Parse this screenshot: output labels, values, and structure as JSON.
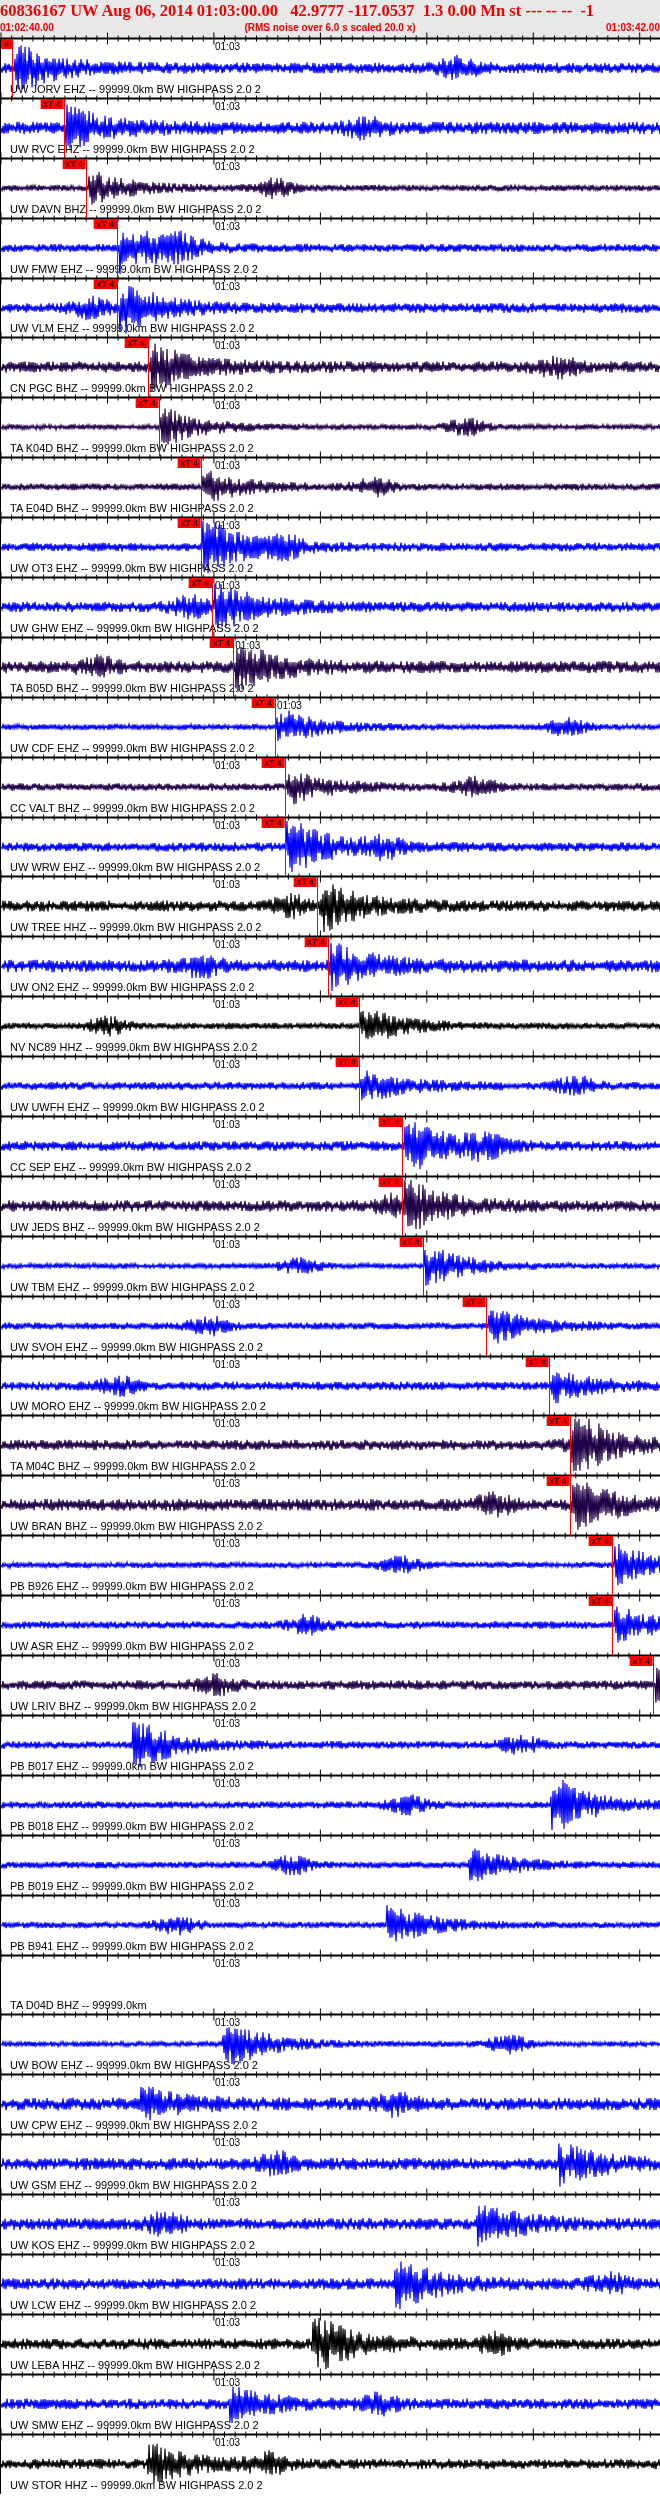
{
  "header": {
    "title": "60836167 UW Aug 06, 2014 01:03:00.00   42.9777 -117.0537  1.3 0.00 Mn st --- -- --  -1",
    "start_time": "01:02:40.00",
    "note": "(RMS noise over 6.0 s scaled 20.0 x)",
    "end_time": "01:03:42.00"
  },
  "traces": [
    {
      "label": "UW JORV EHZ -- 99999.0km BW HIGHPASS 2.0 2",
      "time_label": "01:03",
      "color": "#0000ff",
      "kind": "waveform",
      "pick": {
        "label": "4",
        "level": 0.017
      }
    },
    {
      "label": "UW RVC EHZ -- 99999.0km BW HIGHPASS 2.0 2",
      "time_label": "01:03",
      "color": "#0000ff",
      "kind": "waveform",
      "pick": {
        "label": "xT 4",
        "level": 0.095
      }
    },
    {
      "label": "UW DAVN BHZ -- 99999.0km BW HIGHPASS 2.0 2",
      "time_label": "01:03",
      "color": "#200048",
      "kind": "waveform",
      "pick": {
        "label": "xT 4",
        "level": 0.129
      }
    },
    {
      "label": "UW FMW EHZ -- 99999.0km BW HIGHPASS 2.0 2",
      "time_label": "01:03",
      "color": "#0000ff",
      "kind": "waveform",
      "pick": {
        "label": "xT 4",
        "level": 0.176
      }
    },
    {
      "label": "UW VLM EHZ -- 99999.0km BW HIGHPASS 2.0 2",
      "time_label": "01:03",
      "color": "#0000ff",
      "kind": "waveform",
      "pick": {
        "label": "xT 4",
        "level": 0.176
      }
    },
    {
      "label": "CN PGC BHZ -- 99999.0km BW HIGHPASS 2.0 2",
      "time_label": "01:03",
      "color": "#200048",
      "kind": "waveform",
      "pick": {
        "label": "xT 4",
        "level": 0.223
      }
    },
    {
      "label": "TA K04D BHZ -- 99999.0km BW HIGHPASS 2.0 2",
      "time_label": "01:03",
      "color": "#200048",
      "kind": "waveform",
      "pick": {
        "label": "xT 4",
        "level": 0.239
      }
    },
    {
      "label": "TA E04D BHZ -- 99999.0km BW HIGHPASS 2.0 2",
      "time_label": "01:03",
      "color": "#200048",
      "kind": "waveform",
      "pick": {
        "label": "xT 4",
        "level": 0.303
      }
    },
    {
      "label": "UW OT3 EHZ -- 99999.0km BW HIGHPASS 2.0 2",
      "time_label": "01:03",
      "color": "#0000ff",
      "kind": "waveform",
      "pick": {
        "label": "xT 4",
        "level": 0.303
      }
    },
    {
      "label": "UW GHW EHZ -- 99999.0km BW HIGHPASS 2.0 2",
      "time_label": "01:03",
      "color": "#0000ff",
      "kind": "waveform",
      "pick": {
        "label": "xT 4",
        "level": 0.32
      }
    },
    {
      "label": "TA B05D BHZ -- 99999.0km BW HIGHPASS 2.0 2",
      "time_label": "01:03",
      "color": "#200048",
      "kind": "waveform",
      "pick": {
        "label": "xT 4",
        "level": 0.352
      }
    },
    {
      "label": "UW CDF EHZ -- 99999.0km BW HIGHPASS 2.0 2",
      "time_label": "01:03",
      "color": "#0000ff",
      "kind": "waveform",
      "pick": {
        "label": "xT 4",
        "level": 0.415
      }
    },
    {
      "label": "CC VALT BHZ -- 99999.0km BW HIGHPASS 2.0 2",
      "time_label": "01:03",
      "color": "#200048",
      "kind": "waveform",
      "pick": {
        "label": "xT 4",
        "level": 0.43
      }
    },
    {
      "label": "UW WRW EHZ -- 99999.0km BW HIGHPASS 2.0 2",
      "time_label": "01:03",
      "color": "#0000ff",
      "kind": "waveform",
      "pick": {
        "label": "xT 4",
        "level": 0.43
      }
    },
    {
      "label": "UW TREE HHZ -- 99999.0km BW HIGHPASS 2.0 2",
      "time_label": "01:03",
      "color": "#000000",
      "kind": "waveform",
      "pick": {
        "label": "xT 4",
        "level": 0.479
      }
    },
    {
      "label": "UW ON2 EHZ -- 99999.0km BW HIGHPASS 2.0 2",
      "time_label": "01:03",
      "color": "#0000ff",
      "kind": "waveform",
      "pick": {
        "label": "xT 4",
        "level": 0.495
      }
    },
    {
      "label": "NV NC89 HHZ -- 99999.0km BW HIGHPASS 2.0 2",
      "time_label": "01:03",
      "color": "#000000",
      "kind": "waveform",
      "pick": {
        "label": "xT 4",
        "level": 0.542
      }
    },
    {
      "label": "UW UWFH EHZ -- 99999.0km BW HIGHPASS 2.0 2",
      "time_label": "01:03",
      "color": "#0000ff",
      "kind": "waveform",
      "pick": {
        "label": "xT 4",
        "level": 0.542
      }
    },
    {
      "label": "CC SEP EHZ -- 99999.0km BW HIGHPASS 2.0 2",
      "time_label": "01:03",
      "color": "#0000ff",
      "kind": "waveform",
      "pick": {
        "label": "xT 4",
        "level": 0.608
      }
    },
    {
      "label": "UW JEDS BHZ -- 99999.0km BW HIGHPASS 2.0 2",
      "time_label": "01:03",
      "color": "#200048",
      "kind": "waveform",
      "pick": {
        "label": "xT 4",
        "level": 0.608
      }
    },
    {
      "label": "UW TBM EHZ -- 99999.0km BW HIGHPASS 2.0 2",
      "time_label": "01:03",
      "color": "#0000ff",
      "kind": "waveform",
      "pick": {
        "label": "xT 4",
        "level": 0.639
      }
    },
    {
      "label": "UW SVOH EHZ -- 99999.0km BW HIGHPASS 2.0 2",
      "time_label": "01:03",
      "color": "#0000ff",
      "kind": "waveform",
      "pick": {
        "label": "xT 4",
        "level": 0.735
      }
    },
    {
      "label": "UW MORO EHZ -- 99999.0km BW HIGHPASS 2.0 2",
      "time_label": "01:03",
      "color": "#0000ff",
      "kind": "waveform",
      "pick": {
        "label": "xT 4",
        "level": 0.83
      }
    },
    {
      "label": "TA M04C BHZ -- 99999.0km BW HIGHPASS 2.0 2",
      "time_label": "01:03",
      "color": "#200048",
      "kind": "waveform",
      "pick": {
        "label": "xT 4",
        "level": 0.862
      }
    },
    {
      "label": "UW BRAN BHZ -- 99999.0km BW HIGHPASS 2.0 2",
      "time_label": "01:03",
      "color": "#200048",
      "kind": "waveform",
      "pick": {
        "label": "xT 4",
        "level": 0.862
      }
    },
    {
      "label": "PB B926 EHZ -- 99999.0km BW HIGHPASS 2.0 2",
      "time_label": "01:03",
      "color": "#0000ff",
      "kind": "waveform",
      "pick": {
        "label": "xT 4",
        "level": 0.926
      }
    },
    {
      "label": "UW ASR EHZ -- 99999.0km BW HIGHPASS 2.0 2",
      "time_label": "01:03",
      "color": "#0000ff",
      "kind": "waveform",
      "pick": {
        "label": "xT 4",
        "level": 0.926
      }
    },
    {
      "label": "UW LRIV BHZ -- 99999.0km BW HIGHPASS 2.0 2",
      "time_label": "01:03",
      "color": "#200048",
      "kind": "waveform",
      "pick": {
        "label": "xT 4",
        "level": 0.988
      }
    },
    {
      "label": "PB B017 EHZ -- 99999.0km BW HIGHPASS 2.0 2",
      "time_label": "01:03",
      "color": "#0000ff",
      "kind": "waveform"
    },
    {
      "label": "PB B018 EHZ -- 99999.0km BW HIGHPASS 2.0 2",
      "time_label": "01:03",
      "color": "#0000ff",
      "kind": "waveform"
    },
    {
      "label": "PB B019 EHZ -- 99999.0km BW HIGHPASS 2.0 2",
      "time_label": "01:03",
      "color": "#0000ff",
      "kind": "waveform"
    },
    {
      "label": "PB B941 EHZ -- 99999.0km BW HIGHPASS 2.0 2",
      "time_label": "01:03",
      "color": "#0000ff",
      "kind": "waveform"
    },
    {
      "label": "TA D04D BHZ -- 99999.0km",
      "time_label": "01:03",
      "kind": "blank"
    },
    {
      "label": "UW BOW EHZ -- 99999.0km BW HIGHPASS 2.0 2",
      "time_label": "01:03",
      "color": "#0000ff",
      "kind": "waveform"
    },
    {
      "label": "UW CPW EHZ -- 99999.0km BW HIGHPASS 2.0 2",
      "time_label": "01:03",
      "color": "#0000ff",
      "kind": "waveform"
    },
    {
      "label": "UW GSM EHZ -- 99999.0km BW HIGHPASS 2.0 2",
      "time_label": "01:03",
      "color": "#0000ff",
      "kind": "waveform"
    },
    {
      "label": "UW KOS EHZ -- 99999.0km BW HIGHPASS 2.0 2",
      "time_label": "01:03",
      "color": "#0000ff",
      "kind": "waveform"
    },
    {
      "label": "UW LCW EHZ -- 99999.0km BW HIGHPASS 2.0 2",
      "time_label": "01:03",
      "color": "#0000ff",
      "kind": "waveform"
    },
    {
      "label": "UW LEBA HHZ -- 99999.0km BW HIGHPASS 2.0 2",
      "time_label": "01:03",
      "color": "#000000",
      "kind": "waveform"
    },
    {
      "label": "UW SMW EHZ -- 99999.0km BW HIGHPASS 2.0 2",
      "time_label": "01:03",
      "color": "#0000ff",
      "kind": "waveform"
    },
    {
      "label": "UW STOR HHZ -- 99999.0km BW HIGHPASS 2.0 2",
      "time_label": "01:03",
      "color": "#000000",
      "kind": "waveform"
    }
  ]
}
